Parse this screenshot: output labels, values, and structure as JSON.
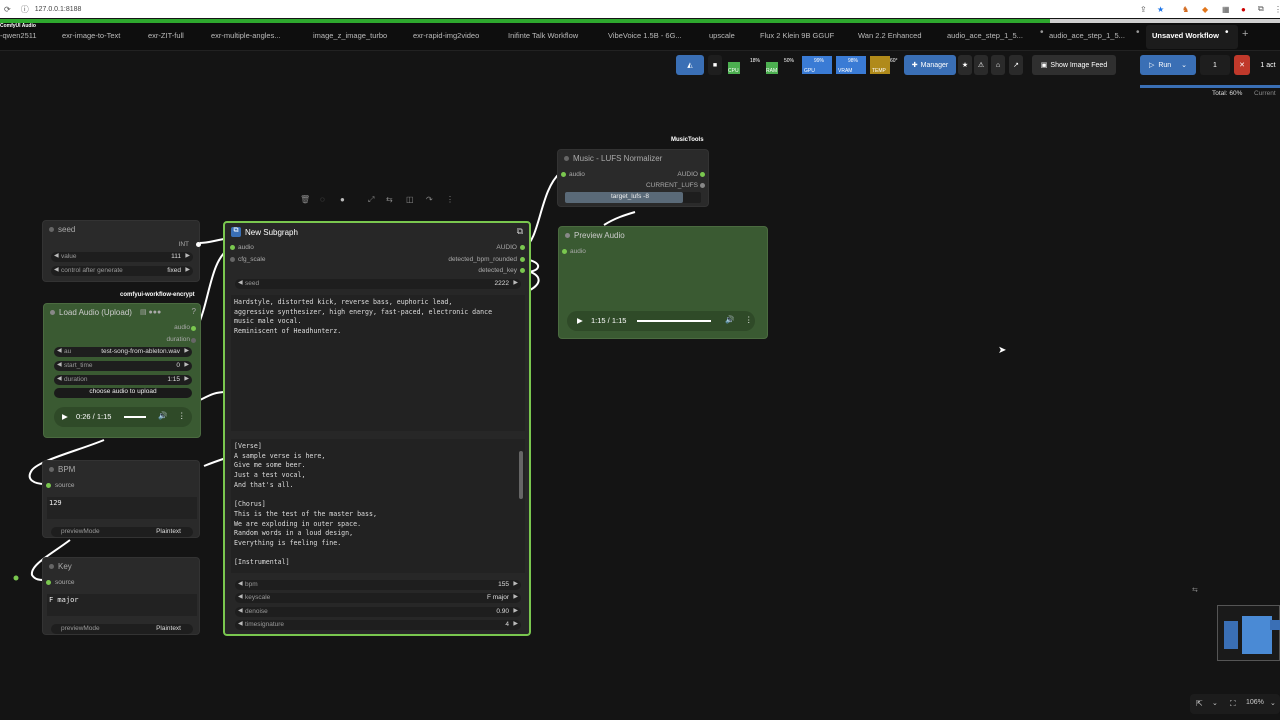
{
  "browser": {
    "url": "127.0.0.1:8188"
  },
  "app": {
    "brand": "ComfyUI Audio"
  },
  "tabs": [
    {
      "label": "-qwen2511"
    },
    {
      "label": "exr-image-to-Text"
    },
    {
      "label": "exr-ZIT-full"
    },
    {
      "label": "exr-multiple-angles..."
    },
    {
      "label": "image_z_image_turbo"
    },
    {
      "label": "exr-rapid-img2video"
    },
    {
      "label": "Inifinte Talk Workflow"
    },
    {
      "label": "VibeVoice 1.5B - 6G..."
    },
    {
      "label": "upscale"
    },
    {
      "label": "Flux 2 Klein 9B GGUF"
    },
    {
      "label": "Wan 2.2 Enhanced"
    },
    {
      "label": "audio_ace_step_1_5..."
    },
    {
      "label": "audio_ace_step_1_5..."
    },
    {
      "label": "Unsaved Workflow"
    }
  ],
  "toolbar": {
    "meters": [
      {
        "label": "CPU",
        "value": "18%",
        "color": "#4caf50"
      },
      {
        "label": "RAM",
        "value": "50%",
        "color": "#4caf50"
      },
      {
        "label": "GPU",
        "value": "99%",
        "color": "#3a7bd5"
      },
      {
        "label": "VRAM",
        "value": "98%",
        "color": "#3a7bd5"
      },
      {
        "label": "TEMP",
        "value": "60°",
        "color": "#b08a1a"
      }
    ],
    "manager_label": "Manager",
    "image_feed_label": "Show Image Feed",
    "run_label": "Run",
    "queue_count": "1",
    "actions_label": "1 act",
    "total_label": "Total: 60%",
    "current_label": "Current"
  },
  "selection_toolbar": [
    "trash-icon",
    "circle-icon",
    "color-icon",
    "fit-icon",
    "convert-icon",
    "bypass-icon",
    "redo-icon",
    "more-icon"
  ],
  "nodes": {
    "seed": {
      "title": "seed",
      "output": "INT",
      "value_label": "value",
      "value": "111",
      "control_label": "control after generate",
      "control_value": "fixed"
    },
    "load_audio": {
      "badge": "comfyui-workflow-encrypt",
      "title": "Load Audio (Upload)",
      "outputs": [
        "audio",
        "duration"
      ],
      "audio_label": "au",
      "audio_value": "test-song-from-ableton.wav",
      "start_label": "start_time",
      "start_value": "0",
      "duration_label": "duration",
      "duration_value": "1:15",
      "upload_label": "choose audio to upload",
      "player_time": "0:26 / 1:15"
    },
    "bpm": {
      "title": "BPM",
      "input": "source",
      "value": "129",
      "mode_label": "previewMode",
      "mode_value": "Plaintext"
    },
    "key": {
      "title": "Key",
      "input": "source",
      "value": "F major",
      "mode_label": "previewMode",
      "mode_value": "Plaintext"
    },
    "subgraph": {
      "title": "New Subgraph",
      "inputs": [
        "audio",
        "cfg_scale"
      ],
      "outputs": [
        "AUDIO",
        "detected_bpm_rounded",
        "detected_key"
      ],
      "seed_label": "seed",
      "seed_value": "2222",
      "prompt": "Hardstyle, distorted kick, reverse bass, euphoric lead,\naggressive synthesizer, high energy, fast-paced, electronic dance\nmusic male vocal.\nReminiscent of Headhunterz.",
      "lyrics": "[Verse]\nA sample verse is here,\nGive me some beer.\nJust a test vocal,\nAnd that's all.\n\n[Chorus]\nThis is the test of the master bass,\nWe are exploding in outer space.\nRandom words in a loud design,\nEverything is feeling fine.\n\n[Instrumental]",
      "params": [
        {
          "label": "bpm",
          "value": "155"
        },
        {
          "label": "keyscale",
          "value": "F major"
        },
        {
          "label": "denoise",
          "value": "0.90"
        },
        {
          "label": "timesignature",
          "value": "4"
        }
      ]
    },
    "lufs": {
      "badge": "MusicTools",
      "title": "Music - LUFS Normalizer",
      "input": "audio",
      "outputs": [
        "AUDIO",
        "CURRENT_LUFS"
      ],
      "target_label": "target_lufs",
      "target_value": "-8"
    },
    "preview": {
      "title": "Preview Audio",
      "input": "audio",
      "player_time": "1:15 / 1:15"
    }
  },
  "statusbar": {
    "zoom": "106%"
  }
}
